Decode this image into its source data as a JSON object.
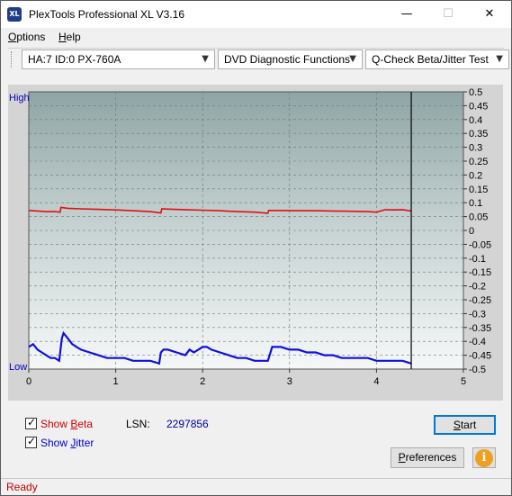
{
  "window": {
    "title": "PlexTools Professional XL V3.16",
    "icon_text": "XL",
    "min_glyph": "—",
    "max_glyph": "☐",
    "close_glyph": "✕"
  },
  "menu": {
    "items": [
      {
        "label": "Options",
        "u": "O",
        "rest": "ptions"
      },
      {
        "label": "Help",
        "u": "H",
        "rest": "elp"
      }
    ]
  },
  "toolbar": {
    "drive": "HA:7 ID:0  PX-760A",
    "function": "DVD Diagnostic Functions",
    "test": "Q-Check Beta/Jitter Test"
  },
  "chart_data": {
    "type": "line",
    "y_left_labels": {
      "top": "High",
      "bottom": "Low"
    },
    "x_ticks": [
      "0",
      "1",
      "2",
      "3",
      "4",
      "5"
    ],
    "xlim": [
      0,
      5
    ],
    "ylim": [
      -0.5,
      0.5
    ],
    "y_ticks": [
      "0.5",
      "0.45",
      "0.4",
      "0.35",
      "0.3",
      "0.25",
      "0.2",
      "0.15",
      "0.1",
      "0.05",
      "0",
      "-0.05",
      "-0.1",
      "-0.15",
      "-0.2",
      "-0.25",
      "-0.3",
      "-0.35",
      "-0.4",
      "-0.45",
      "-0.5"
    ],
    "end_marker_x": 4.4,
    "grid": true,
    "series": [
      {
        "color": "#e01010",
        "x": [
          0,
          0.1,
          0.2,
          0.3,
          0.36,
          0.37,
          0.45,
          0.6,
          0.8,
          1.0,
          1.2,
          1.4,
          1.52,
          1.53,
          1.6,
          1.8,
          2.0,
          2.2,
          2.4,
          2.6,
          2.75,
          2.76,
          2.9,
          3.1,
          3.3,
          3.5,
          3.7,
          3.9,
          4.0,
          4.1,
          4.2,
          4.3,
          4.4
        ],
        "y": [
          0.072,
          0.07,
          0.068,
          0.068,
          0.066,
          0.083,
          0.08,
          0.078,
          0.076,
          0.074,
          0.071,
          0.068,
          0.063,
          0.078,
          0.077,
          0.075,
          0.073,
          0.071,
          0.068,
          0.066,
          0.062,
          0.072,
          0.072,
          0.071,
          0.071,
          0.07,
          0.069,
          0.068,
          0.066,
          0.075,
          0.074,
          0.075,
          0.07
        ]
      },
      {
        "color": "#1010e0",
        "x": [
          0,
          0.05,
          0.1,
          0.15,
          0.2,
          0.25,
          0.3,
          0.35,
          0.38,
          0.4,
          0.45,
          0.5,
          0.55,
          0.6,
          0.7,
          0.8,
          0.9,
          1.0,
          1.1,
          1.2,
          1.3,
          1.4,
          1.5,
          1.52,
          1.55,
          1.6,
          1.7,
          1.8,
          1.85,
          1.9,
          1.95,
          2.0,
          2.05,
          2.1,
          2.2,
          2.3,
          2.4,
          2.5,
          2.6,
          2.7,
          2.75,
          2.8,
          2.9,
          3.0,
          3.1,
          3.2,
          3.3,
          3.4,
          3.5,
          3.6,
          3.7,
          3.8,
          3.9,
          4.0,
          4.1,
          4.2,
          4.3,
          4.4
        ],
        "y": [
          -0.42,
          -0.41,
          -0.43,
          -0.44,
          -0.45,
          -0.46,
          -0.46,
          -0.47,
          -0.39,
          -0.37,
          -0.39,
          -0.41,
          -0.42,
          -0.43,
          -0.44,
          -0.45,
          -0.46,
          -0.46,
          -0.46,
          -0.47,
          -0.47,
          -0.47,
          -0.48,
          -0.44,
          -0.43,
          -0.43,
          -0.44,
          -0.45,
          -0.43,
          -0.44,
          -0.43,
          -0.42,
          -0.42,
          -0.43,
          -0.44,
          -0.45,
          -0.46,
          -0.46,
          -0.47,
          -0.47,
          -0.47,
          -0.42,
          -0.42,
          -0.43,
          -0.43,
          -0.44,
          -0.44,
          -0.45,
          -0.45,
          -0.46,
          -0.46,
          -0.46,
          -0.46,
          -0.47,
          -0.47,
          -0.47,
          -0.47,
          -0.48
        ]
      }
    ]
  },
  "bottom": {
    "show_beta": {
      "label": "Show Beta",
      "u": "B",
      "before": "Show ",
      "after": "eta",
      "color": "#cc0000",
      "checked": true
    },
    "show_jitter": {
      "label": "Show Jitter",
      "u": "J",
      "before": "Show ",
      "after": "itter",
      "color": "#0000cc",
      "checked": true
    },
    "lsn_label": "LSN:",
    "lsn_value": "2297856",
    "start_label": "Start",
    "start_u": "S",
    "start_rest": "tart",
    "preferences_label": "Preferences",
    "preferences_u": "P",
    "preferences_rest": "references",
    "info_glyph": "i"
  },
  "status": {
    "text": "Ready"
  }
}
